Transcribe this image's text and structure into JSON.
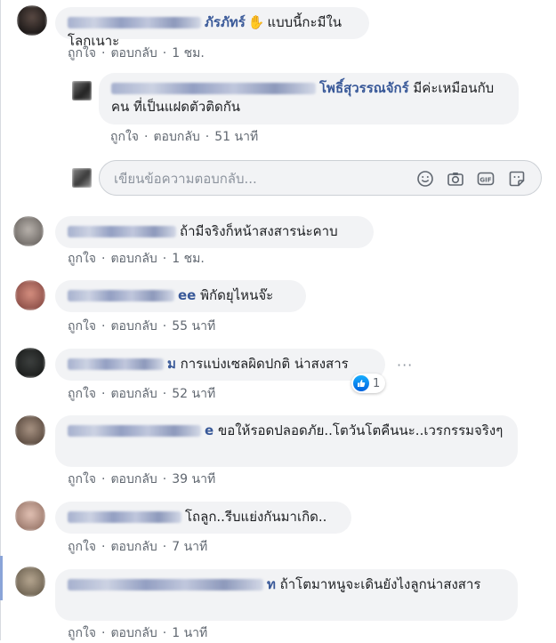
{
  "actions": {
    "like": "ถูกใจ",
    "reply": "ตอบกลับ",
    "sep": "·"
  },
  "comments": [
    {
      "name_tail": "ภัรภัทร์",
      "text": "แบบนี้กะมีในโลกเนาะ",
      "time": "1 ชม."
    },
    {
      "name_tail": "โพธิ์สุวรรณจักร์",
      "text": "มีค่ะเหมือนกับคน ที่เป็นแฝดตัวติดกัน",
      "time": "51 นาที",
      "is_reply": true
    },
    {
      "name_tail": "",
      "text": "ถ้ามีจริงก็หน้าสงสารน่ะคาบ",
      "time": "1 ชม."
    },
    {
      "name_tail": "ee",
      "text": "พิกัดยุไหนจ๊ะ",
      "time": "55 นาที"
    },
    {
      "name_tail": "ม",
      "text": "การแบ่งเซลผิดปกติ น่าสงสาร",
      "time": "52 นาที",
      "reactions": "1"
    },
    {
      "name_tail": "e",
      "text": "ขอให้รอดปลอดภัย..โตวันโตคืนนะ..เวรกรรมจริงๆ",
      "time": "39 นาที"
    },
    {
      "name_tail": "",
      "text": "โถลูก..รีบแย่งกันมาเกิด..",
      "time": "7 นาที"
    },
    {
      "name_tail": "ท",
      "text": "ถ้าโตมาหนูจะเดินยังไงลูกน่าสงสาร",
      "time": "1 นาที"
    }
  ],
  "reply_box": {
    "placeholder": "เขียนข้อความตอบกลับ...",
    "tools": [
      "emoji-icon",
      "camera-icon",
      "gif-icon",
      "sticker-icon"
    ]
  },
  "more": "···",
  "colors": {
    "name": "#385898",
    "bubble": "#f2f3f5",
    "meta": "#606770",
    "like": "#1877f2"
  }
}
